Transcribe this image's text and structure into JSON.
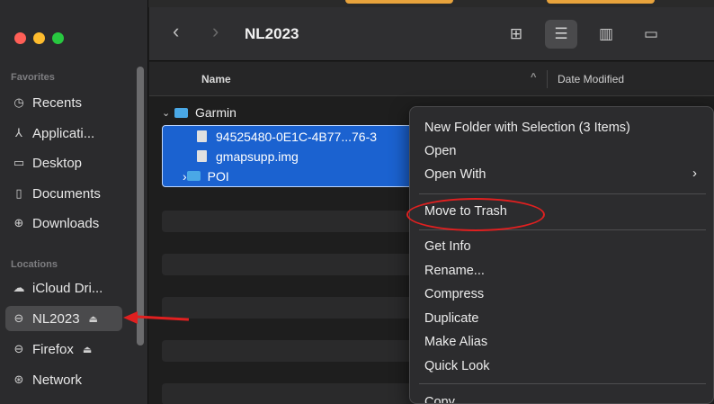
{
  "window": {
    "title": "NL2023"
  },
  "sidebar": {
    "favorites_label": "Favorites",
    "favorites": [
      {
        "icon": "clock-icon",
        "label": "Recents"
      },
      {
        "icon": "applications-icon",
        "label": "Applicati..."
      },
      {
        "icon": "desktop-icon",
        "label": "Desktop"
      },
      {
        "icon": "document-icon",
        "label": "Documents"
      },
      {
        "icon": "download-icon",
        "label": "Downloads"
      }
    ],
    "locations_label": "Locations",
    "locations": [
      {
        "icon": "cloud-icon",
        "label": "iCloud Dri..."
      },
      {
        "icon": "drive-icon",
        "label": "NL2023",
        "eject": "⏏",
        "selected": true
      },
      {
        "icon": "drive-icon",
        "label": "Firefox",
        "eject": "⏏"
      },
      {
        "icon": "network-icon",
        "label": "Network"
      }
    ]
  },
  "list_header": {
    "name": "Name",
    "date_modified": "Date Modified"
  },
  "files": [
    {
      "name": "Garmin",
      "type": "folder",
      "expanded": true
    },
    {
      "name": "94525480-0E1C-4B77...76-3",
      "type": "file",
      "selected": true
    },
    {
      "name": "gmapsupp.img",
      "type": "file",
      "selected": true
    },
    {
      "name": "POI",
      "type": "folder",
      "selected": true
    }
  ],
  "context_menu": {
    "items": [
      "New Folder with Selection (3 Items)",
      "Open",
      "Open With",
      "Move to Trash",
      "Get Info",
      "Rename...",
      "Compress",
      "Duplicate",
      "Make Alias",
      "Quick Look",
      "Copy"
    ],
    "submenu_arrow": "›"
  },
  "colors": {
    "selection": "#1b62d0",
    "annotation": "#e02020",
    "folder": "#4aa8e6"
  }
}
